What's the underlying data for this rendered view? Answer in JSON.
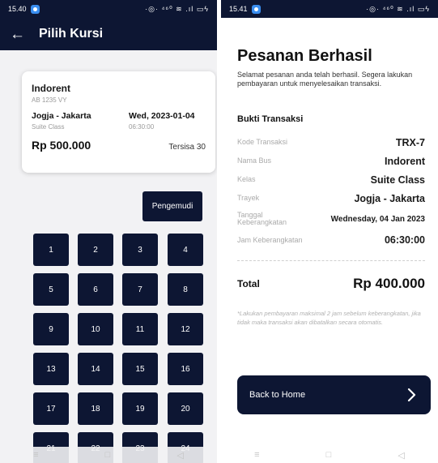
{
  "left": {
    "status_time": "15.40",
    "status_icons": "·◎· ⁴⁶⁰ ≋ .ıl ▭ϟ",
    "appbar": {
      "back_icon": "←",
      "title": "Pilih Kursi"
    },
    "ticket": {
      "bus_name": "Indorent",
      "plate": "AB 1235 VY",
      "route": "Jogja - Jakarta",
      "class": "Suite Class",
      "date": "Wed, 2023-01-04",
      "time": "06:30:00",
      "price": "Rp 500.000",
      "remaining": "Tersisa 30"
    },
    "driver_label": "Pengemudi",
    "seats": [
      "1",
      "2",
      "3",
      "4",
      "5",
      "6",
      "7",
      "8",
      "9",
      "10",
      "11",
      "12",
      "13",
      "14",
      "15",
      "16",
      "17",
      "18",
      "19",
      "20",
      "21",
      "22",
      "23",
      "24"
    ]
  },
  "right": {
    "status_time": "15.41",
    "status_icons": "·◎· ⁴⁶⁰ ≋ .ıl ▭ϟ",
    "title": "Pesanan Berhasil",
    "message": "Selamat pesanan anda telah berhasil. Segera lakukan pembayaran untuk menyelesaikan transaksi.",
    "section_title": "Bukti Transaksi",
    "details": [
      {
        "label": "Kode Transaksi",
        "value": "TRX-7"
      },
      {
        "label": "Nama Bus",
        "value": "Indorent"
      },
      {
        "label": "Kelas",
        "value": "Suite Class"
      },
      {
        "label": "Trayek",
        "value": "Jogja - Jakarta"
      },
      {
        "label": "Tanggal Keberangkatan",
        "value": "Wednesday, 04 Jan 2023"
      },
      {
        "label": "Jam Keberangkatan",
        "value": "06:30:00"
      }
    ],
    "total_label": "Total",
    "total_value": "Rp 400.000",
    "note": "*Lakukan pembayaran maksimal 2 jam sebelum keberangkatan, jika tidak maka transaksi akan dibatalkan secara otomatis.",
    "home_button": "Back to Home",
    "home_arrow_icon": "chevron-right-icon"
  },
  "navbar": {
    "menu_icon": "≡",
    "home_icon": "□",
    "back_icon": "◁"
  },
  "colors": {
    "primary": "#0d1633",
    "background_left": "#f2f2f4",
    "muted": "#aaaaaa"
  }
}
